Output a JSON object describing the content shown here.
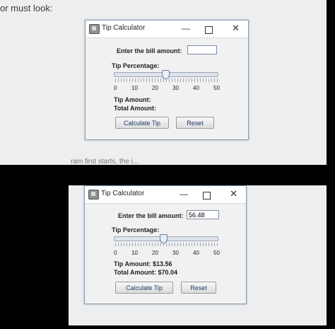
{
  "caption_top": "or must look:",
  "caption_mid": "ram first starts, the i...",
  "windows": [
    {
      "title": "Tip Calculator",
      "min_glyph": "—",
      "close_glyph": "✕",
      "bill_label": "Enter the bill amount:",
      "bill_value": "",
      "tip_label": "Tip Percentage:",
      "slider": {
        "min": 0,
        "max": 50,
        "value": 25
      },
      "ticks": [
        "0",
        "10",
        "20",
        "30",
        "40",
        "50"
      ],
      "tip_amount": "Tip Amount:",
      "total_amount": "Total Amount:",
      "calc_button": "Calculate Tip",
      "reset_button": "Reset"
    },
    {
      "title": "Tip Calculator",
      "min_glyph": "—",
      "close_glyph": "✕",
      "bill_label": "Enter the bill amount:",
      "bill_value": "56.48",
      "tip_label": "Tip Percentage:",
      "slider": {
        "min": 0,
        "max": 50,
        "value": 24
      },
      "ticks": [
        "0",
        "10",
        "20",
        "30",
        "40",
        "50"
      ],
      "tip_amount": "Tip Amount: $13.56",
      "total_amount": "Total Amount: $70.04",
      "calc_button": "Calculate Tip",
      "reset_button": "Reset"
    }
  ]
}
